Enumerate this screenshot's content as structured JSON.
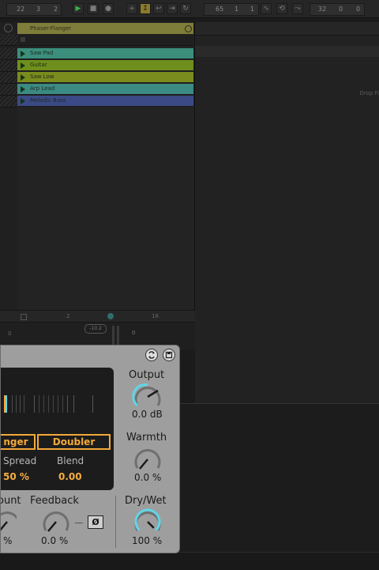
{
  "transport": {
    "tempo_bar": "22",
    "tempo_beat": "3",
    "tempo_sixteenth": "2",
    "arrangement_bar": "65",
    "arrangement_beat": "1",
    "arrangement_sixteenth": "1",
    "loop_bar": "32",
    "loop_beat": "0",
    "loop_sixteenth": "0"
  },
  "track": {
    "name": "Phaser-Flanger",
    "color": "#7f7d3a",
    "clips": [
      {
        "name": "Saw Pad",
        "color": "#3b8f7c"
      },
      {
        "name": "Guitar",
        "color": "#6f8f1d"
      },
      {
        "name": "Saw Low",
        "color": "#7a8c1d"
      },
      {
        "name": "Arp Lead",
        "color": "#3c8a84"
      },
      {
        "name": "Melodic Bass",
        "color": "#3b4a86"
      }
    ]
  },
  "browser": {
    "drop_text": "Drop Fi"
  },
  "scene_bar": {
    "a": "2",
    "b": "16"
  },
  "mixer": {
    "volume": "-10.2",
    "pan": "0",
    "send": "0"
  },
  "device": {
    "mode_a": "nger",
    "mode_b": "Doubler",
    "spread_label": "Spread",
    "spread_value": "50 %",
    "blend_label": "Blend",
    "blend_value": "0.00",
    "output_label": "Output",
    "output_value": "0.0 dB",
    "warmth_label": "Warmth",
    "warmth_value": "0.0 %",
    "amount_label": "ount",
    "amount_value": "%",
    "feedback_label": "Feedback",
    "feedback_value": "0.0 %",
    "invert_label": "Ø",
    "drywet_label": "Dry/Wet",
    "drywet_value": "100 %",
    "drywet_level": 1.0,
    "accent_color": "#f3a939",
    "knob_color": "#5fd6e8"
  }
}
